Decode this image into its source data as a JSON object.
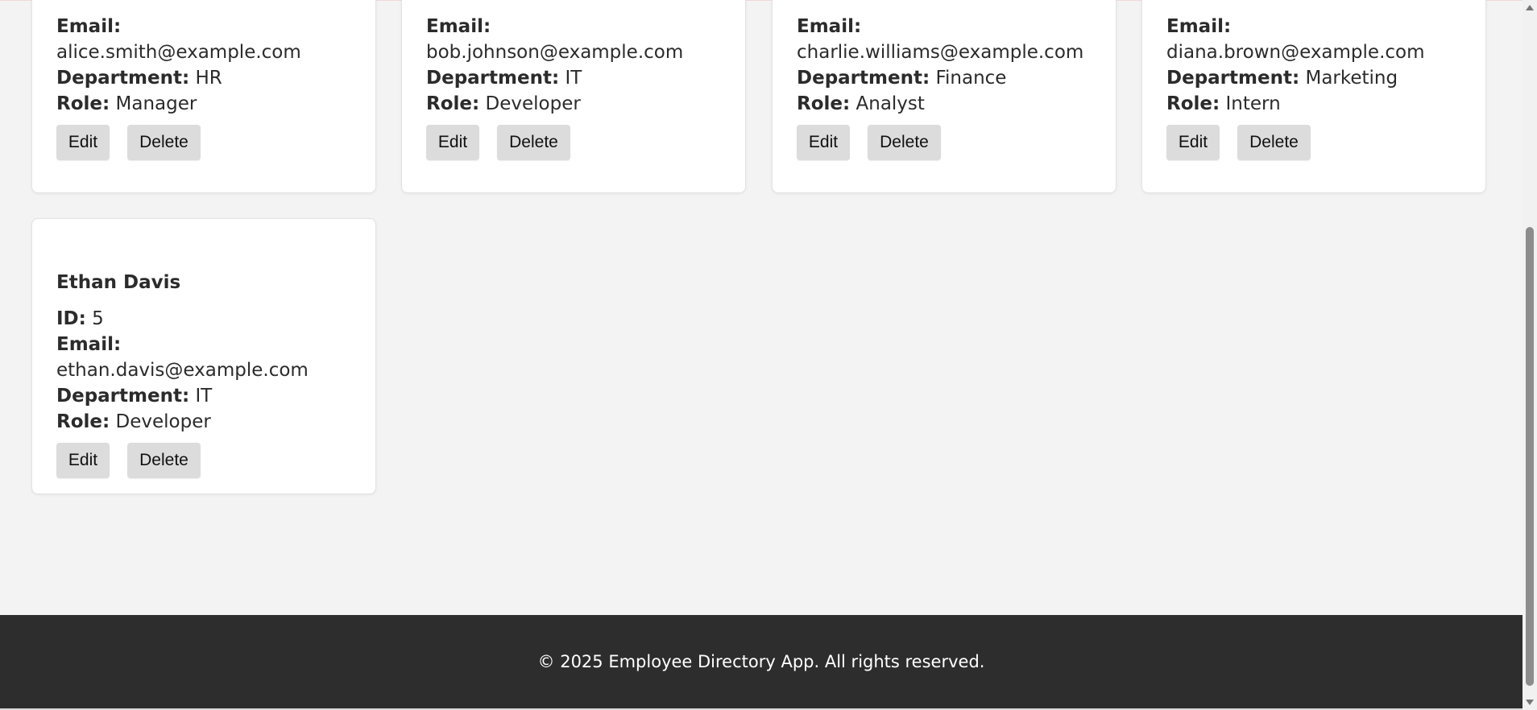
{
  "employees": [
    {
      "email_label": "Email:",
      "email": "alice.smith@example.com",
      "department_label": "Department:",
      "department": "HR",
      "role_label": "Role:",
      "role": "Manager",
      "edit_label": "Edit",
      "delete_label": "Delete"
    },
    {
      "email_label": "Email:",
      "email": "bob.johnson@example.com",
      "department_label": "Department:",
      "department": "IT",
      "role_label": "Role:",
      "role": "Developer",
      "edit_label": "Edit",
      "delete_label": "Delete"
    },
    {
      "email_label": "Email:",
      "email": "charlie.williams@example.com",
      "department_label": "Department:",
      "department": "Finance",
      "role_label": "Role:",
      "role": "Analyst",
      "edit_label": "Edit",
      "delete_label": "Delete"
    },
    {
      "email_label": "Email:",
      "email": "diana.brown@example.com",
      "department_label": "Department:",
      "department": "Marketing",
      "role_label": "Role:",
      "role": "Intern",
      "edit_label": "Edit",
      "delete_label": "Delete"
    },
    {
      "name": "Ethan Davis",
      "id_label": "ID:",
      "id": "5",
      "email_label": "Email:",
      "email": "ethan.davis@example.com",
      "department_label": "Department:",
      "department": "IT",
      "role_label": "Role:",
      "role": "Developer",
      "edit_label": "Edit",
      "delete_label": "Delete"
    }
  ],
  "footer": {
    "text": "© 2025 Employee Directory App. All rights reserved."
  },
  "colors": {
    "background": "#f3f3f3",
    "card": "#ffffff",
    "button": "#dcdcdc",
    "footer": "#2d2d2d"
  }
}
